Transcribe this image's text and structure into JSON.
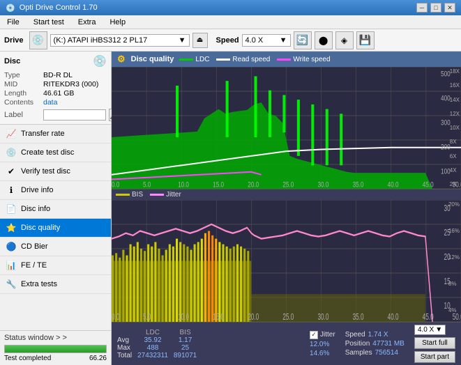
{
  "titleBar": {
    "title": "Opti Drive Control 1.70",
    "minimizeBtn": "─",
    "maximizeBtn": "□",
    "closeBtn": "✕"
  },
  "menuBar": {
    "items": [
      "File",
      "Start test",
      "Extra",
      "Help"
    ]
  },
  "toolbar": {
    "driveLabel": "Drive",
    "driveValue": "(K:)  ATAPI iHBS312  2 PL17",
    "speedLabel": "Speed",
    "speedValue": "4.0 X"
  },
  "disc": {
    "typeLabel": "Type",
    "typeValue": "BD-R DL",
    "midLabel": "MID",
    "midValue": "RITEKDR3 (000)",
    "lengthLabel": "Length",
    "lengthValue": "46.61 GB",
    "contentsLabel": "Contents",
    "contentsValue": "data",
    "labelLabel": "Label"
  },
  "navItems": [
    {
      "id": "transfer-rate",
      "label": "Transfer rate",
      "icon": "📈"
    },
    {
      "id": "create-test-disc",
      "label": "Create test disc",
      "icon": "💿"
    },
    {
      "id": "verify-test-disc",
      "label": "Verify test disc",
      "icon": "✔"
    },
    {
      "id": "drive-info",
      "label": "Drive info",
      "icon": "ℹ"
    },
    {
      "id": "disc-info",
      "label": "Disc info",
      "icon": "📄"
    },
    {
      "id": "disc-quality",
      "label": "Disc quality",
      "icon": "⭐",
      "active": true
    },
    {
      "id": "cd-bier",
      "label": "CD Bier",
      "icon": "🔵"
    },
    {
      "id": "fe-te",
      "label": "FE / TE",
      "icon": "📊"
    },
    {
      "id": "extra-tests",
      "label": "Extra tests",
      "icon": "🔧"
    }
  ],
  "statusWindow": {
    "label": "Status window > >",
    "progressPercent": 100,
    "progressFill": "100.0%",
    "statusText": "Test completed",
    "rightValue": "66.26"
  },
  "discQuality": {
    "title": "Disc quality",
    "legend": [
      {
        "label": "LDC",
        "color": "#00aa00"
      },
      {
        "label": "Read speed",
        "color": "#ffffff"
      },
      {
        "label": "Write speed",
        "color": "#ff44ff"
      }
    ],
    "legend2": [
      {
        "label": "BIS",
        "color": "#cccc00"
      },
      {
        "label": "Jitter",
        "color": "#ff88ff"
      }
    ]
  },
  "stats": {
    "headers": [
      "LDC",
      "BIS"
    ],
    "rows": [
      {
        "label": "Avg",
        "ldc": "35.92",
        "bis": "1.17"
      },
      {
        "label": "Max",
        "ldc": "488",
        "bis": "25"
      },
      {
        "label": "Total",
        "ldc": "27432311",
        "bis": "891071"
      }
    ],
    "jitterLabel": "Jitter",
    "jitterAvg": "12.0%",
    "jitterMax": "14.6%",
    "jitterTotal": "",
    "speedLabel": "Speed",
    "speedValue": "1.74 X",
    "positionLabel": "Position",
    "positionValue": "47731 MB",
    "samplesLabel": "Samples",
    "samplesValue": "756514",
    "speedDropdown": "4.0 X",
    "startFullBtn": "Start full",
    "startPartBtn": "Start part"
  }
}
